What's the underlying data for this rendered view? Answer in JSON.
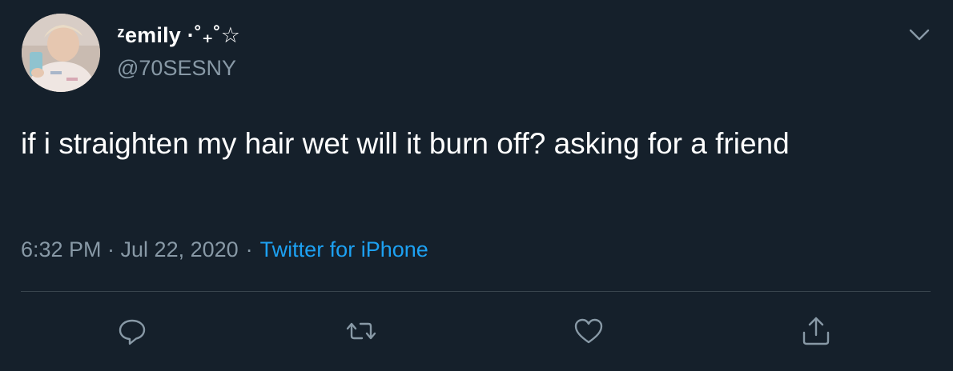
{
  "tweet": {
    "author": {
      "display_name": "ᶻemily ·˚₊˚☆",
      "handle": "@70SESNY"
    },
    "text": "if i straighten my hair wet will it burn off? asking for a friend",
    "timestamp": "6:32 PM · Jul 22, 2020",
    "separator": "·",
    "source": "Twitter for iPhone"
  },
  "icons": {
    "menu": "chevron-down-icon",
    "reply": "reply-icon",
    "retweet": "retweet-icon",
    "like": "heart-icon",
    "share": "share-icon"
  },
  "colors": {
    "background": "#15202b",
    "secondary_text": "#8899a6",
    "link": "#1da1f2",
    "divider": "#38444d"
  }
}
